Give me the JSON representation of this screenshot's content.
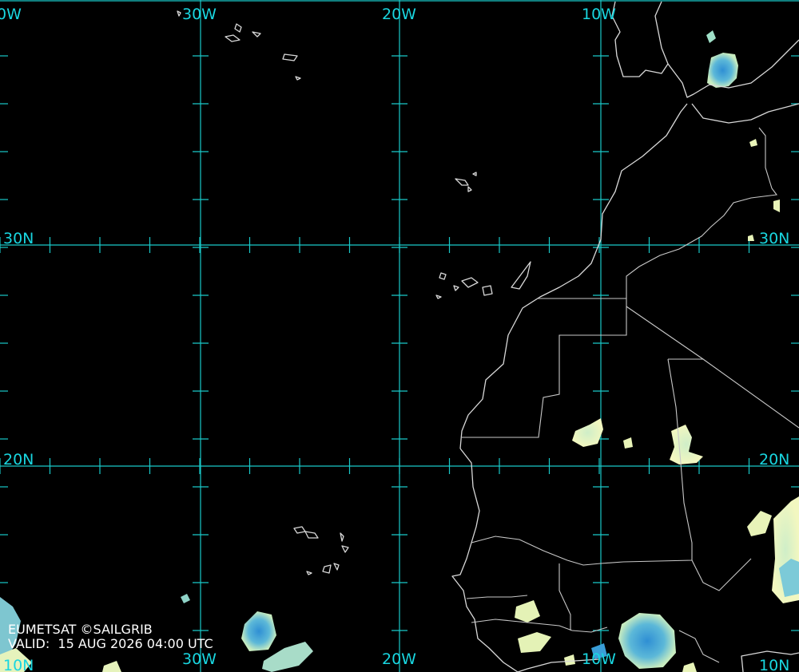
{
  "map": {
    "longitude_labels_top": [
      "30W",
      "20W",
      "10W"
    ],
    "longitude_labels_bottom": [
      "30W",
      "20W",
      "10W"
    ],
    "latitude_labels_right": [
      "30N",
      "20N",
      "10N"
    ],
    "latitude_labels_left": [
      "30N",
      "20N",
      "10N"
    ],
    "edge_label_top_left": "0W",
    "colors": {
      "background": "#000000",
      "grid": "#19c9c9",
      "coastline": "#d8d8d8",
      "cloud_light": "#e8f3b8",
      "cloud_mid": "#8fd3c8",
      "cloud_dense": "#3a9ed8"
    }
  },
  "credit": {
    "source": "EUMETSAT ©SAILGRIB",
    "valid": "VALID:  15 AUG 2026 04:00 UTC"
  }
}
